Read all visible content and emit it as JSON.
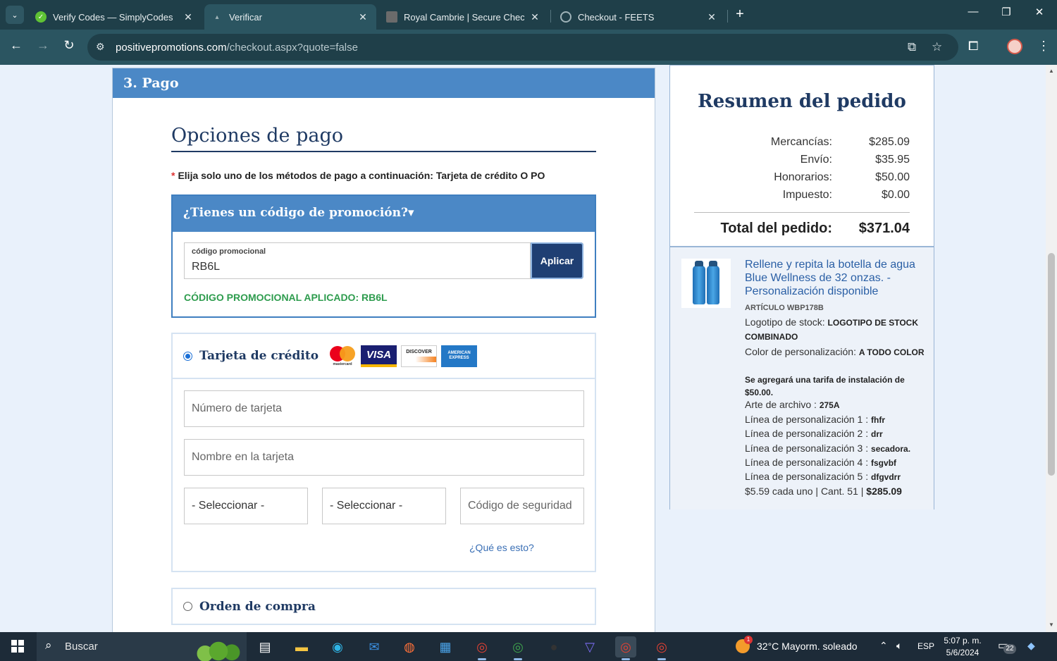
{
  "browser": {
    "tabs": [
      {
        "title": "Verify Codes — SimplyCodes",
        "active": false
      },
      {
        "title": "Verificar",
        "active": true
      },
      {
        "title": "Royal Cambrie | Secure Checkout",
        "active": false
      },
      {
        "title": "Checkout - FEETS",
        "active": false
      }
    ],
    "url_host": "positivepromotions.com",
    "url_path": "/checkout.aspx?quote=false"
  },
  "page": {
    "section_title": "3. Pago",
    "payment_title": "Opciones de pago",
    "instruction_req": "*",
    "instruction": "Elija solo uno de los métodos de pago a continuación: Tarjeta de crédito O PO",
    "promo": {
      "header": "¿Tienes un código de promoción?▾",
      "field_label": "código promocional",
      "field_value": "RB6L",
      "apply_label": "Aplicar",
      "applied_text": "CÓDIGO PROMOCIONAL APLICADO: RB6L"
    },
    "credit_card": {
      "label": "Tarjeta de crédito",
      "card_brands": [
        "mastercard",
        "VISA",
        "DISCOVER",
        "AMERICAN EXPRESS"
      ],
      "card_number_placeholder": "Número de tarjeta",
      "card_name_placeholder": "Nombre en la tarjeta",
      "month_select": "- Seleccionar -",
      "year_select": "- Seleccionar -",
      "security_placeholder": "Código de seguridad",
      "whats_this": "¿Qué es esto?"
    },
    "purchase_order": {
      "label": "Orden de compra"
    }
  },
  "summary": {
    "title": "Resumen del pedido",
    "rows": [
      {
        "label": "Mercancías:",
        "value": "$285.09"
      },
      {
        "label": "Envío:",
        "value": "$35.95"
      },
      {
        "label": "Honorarios:",
        "value": "$50.00"
      },
      {
        "label": "Impuesto:",
        "value": "$0.00"
      }
    ],
    "total_label": "Total del pedido:",
    "total_value": "$371.04",
    "item": {
      "name": "Rellene y repita la botella de agua Blue Wellness de 32 onzas. - Personalización disponible",
      "sku": "ARTÍCULO WBP178B",
      "stock_logo_label": "Logotipo de stock:",
      "stock_logo_value": "LOGOTIPO DE STOCK COMBINADO",
      "color_label": "Color de personalización:",
      "color_value": "A TODO COLOR",
      "setup_note": "Se agregará una tarifa de instalación de $50.00.",
      "art_label": "Arte de archivo :",
      "art_value": "275A",
      "lines": [
        {
          "label": "Línea de personalización 1 :",
          "value": "fhfr"
        },
        {
          "label": "Línea de personalización 2 :",
          "value": "drr"
        },
        {
          "label": "Línea de personalización 3 :",
          "value": "secadora."
        },
        {
          "label": "Línea de personalización 4 :",
          "value": "fsgvbf"
        },
        {
          "label": "Línea de personalización 5 :",
          "value": "dfgvdrr"
        }
      ],
      "price_line": "$5.59 cada uno | Cant. 51 |",
      "price_total": "$285.09"
    }
  },
  "taskbar": {
    "search_label": "Buscar",
    "weather": "32°C  Mayorm. soleado",
    "lang": "ESP",
    "time": "5:07 p. m.",
    "date": "5/6/2024",
    "notifications": "22"
  }
}
